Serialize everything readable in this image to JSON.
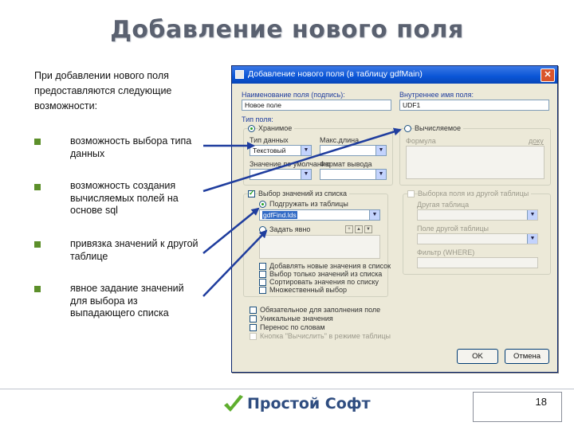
{
  "slide": {
    "title": "Добавление нового поля",
    "intro": "При добавлении нового поля предоставляются следующие возможности:",
    "bullets": [
      "возможность выбора типа данных",
      "возможность создания вычисляемых полей на основе sql",
      "привязка значений к другой таблице",
      "явное задание значений для выбора из выпадающего списка"
    ],
    "page_number": "18",
    "logo_text": "Простой Софт",
    "bullet_color": "#5c8f2a",
    "arrow_color": "#1f3d9e"
  },
  "dialog": {
    "title": "Добавление нового поля (в таблицу gdfMain)",
    "close_label": "✕",
    "name_label": "Наименование поля (подпись):",
    "name_value": "Новое поле",
    "internal_name_label": "Внутреннее имя поля:",
    "internal_name_value": "UDF1",
    "type_label": "Тип поля:",
    "storage_radio": "Хранимое",
    "calculated_radio": "Вычисляемое",
    "data_type_label": "Тип данных",
    "data_type_value": "Текстовый",
    "length_label": "Макс.длина",
    "mask_label": "Значение по умолчанию",
    "format_label": "Формат вывода",
    "formula_label": "Формула",
    "formula_link": "доку",
    "list_checkbox": "Выбор значений из списка",
    "from_table_radio": "Подгружать из таблицы",
    "table_value": "gdfFind.lds",
    "manual_radio": "Задать явно",
    "other_table_checkbox": "Выборка поля из другой таблицы",
    "other_table_fields": [
      "Другая таблица",
      "Поле другой таблицы",
      "Фильтр (WHERE)"
    ],
    "list_options": [
      "Добавлять новые значения в список",
      "Выбор только значений из списка",
      "Сортировать значения по списку",
      "Множественный выбор"
    ],
    "bottom_options": [
      "Обязательное для заполнения поле",
      "Уникальные значения",
      "Перенос по словам",
      "Кнопка \"Вычислить\" в режиме таблицы"
    ],
    "ok_label": "OK",
    "cancel_label": "Отмена"
  }
}
